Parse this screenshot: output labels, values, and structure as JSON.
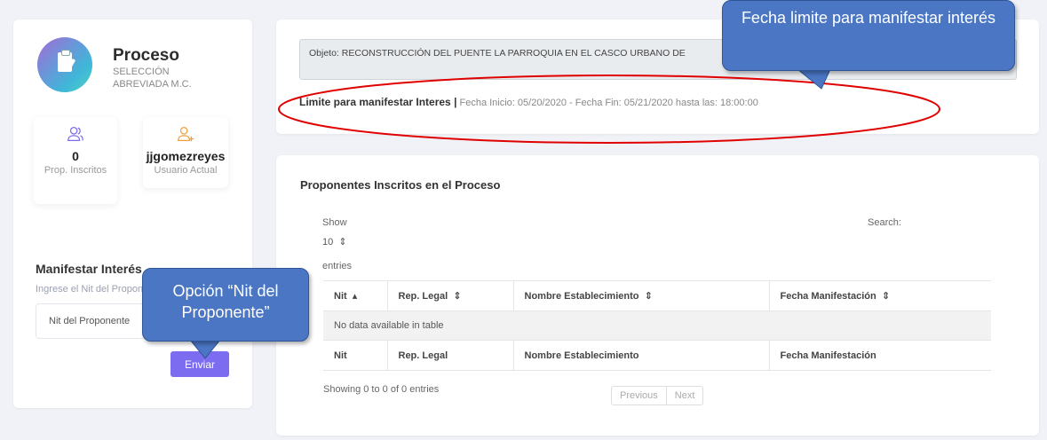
{
  "process_card": {
    "title": "Proceso",
    "subtitle": "SELECCIÓN ABREVIADA M.C.",
    "stats": [
      {
        "value": "0",
        "label": "Prop. Inscritos",
        "icon": "users-icon"
      },
      {
        "value": "jjgomezreyes",
        "label": "Usuario Actual",
        "icon": "add-user-icon"
      }
    ],
    "manifest_title": "Manifestar Interés",
    "manifest_hint": "Ingrese el Nit del Proponente",
    "nit_placeholder": "Nit del Proponente",
    "send_label": "Enviar"
  },
  "info_card": {
    "objeto": "Objeto: RECONSTRUCCIÓN DEL PUENTE LA PARROQUIA EN EL CASCO URBANO DE",
    "limit_title": "Limite para manifestar Interes |",
    "limit_detail": "Fecha Inicio: 05/20/2020 - Fecha Fin: 05/21/2020 hasta las: 18:00:00"
  },
  "proponentes": {
    "title": "Proponentes Inscritos en el Proceso",
    "show_label": "Show",
    "page_length": "10",
    "entries_label": "entries",
    "search_label": "Search:",
    "columns": [
      "Nit",
      "Rep. Legal",
      "Nombre Establecimiento",
      "Fecha Manifestación"
    ],
    "empty_message": "No data available in table",
    "info": "Showing 0 to 0 of 0 entries",
    "prev_label": "Previous",
    "next_label": "Next"
  },
  "annotations": {
    "date_callout": "Fecha limite para manifestar interés",
    "nit_callout": "Opción “Nit del Proponente”",
    "accent_color": "#7c6cf0",
    "callout_color": "#4a76c4",
    "highlight_color": "#e00000"
  }
}
